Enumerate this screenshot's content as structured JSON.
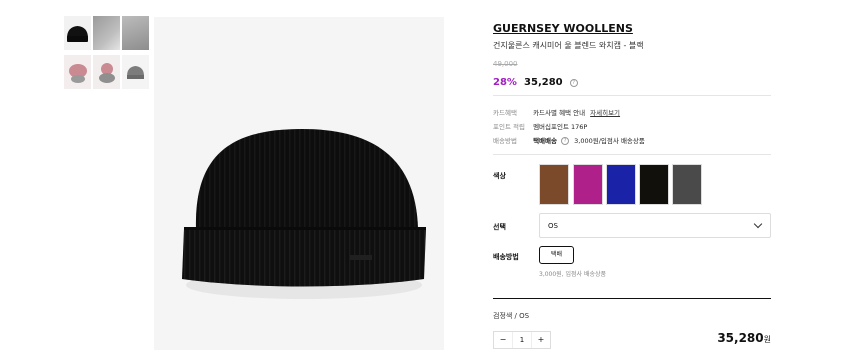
{
  "thumbnails": [
    {
      "label": "black beanie front"
    },
    {
      "label": "model side view"
    },
    {
      "label": "knit close-up"
    },
    {
      "label": "model wearing pink"
    },
    {
      "label": "model wearing pink side"
    },
    {
      "label": "grey beanie"
    }
  ],
  "product": {
    "brand": "GUERNSEY WOOLLENS",
    "name": "건지울른스 캐시미어 울 블렌드 와치캡 - 블랙",
    "original_price": "49,000",
    "discount": "28%",
    "sale_price": "35,280",
    "info_icon": "?"
  },
  "meta": {
    "card_label": "카드혜택",
    "card_value": "카드사별 혜택 안내",
    "card_link": "자세히보기",
    "point_label": "포인트 적립",
    "point_value": "멤버십포인트 176P",
    "delivery_label": "배송방법",
    "delivery_type": "택배배송",
    "delivery_value": "3,000원/입점사 배송상품"
  },
  "colors": {
    "label": "색상",
    "swatches": [
      "#7a4a2a",
      "#b0208a",
      "#1a22a8",
      "#12100a",
      "#4a4a4a"
    ]
  },
  "select": {
    "label": "선택",
    "value": "OS"
  },
  "shipping": {
    "label": "배송방법",
    "button": "택배",
    "note": "3,000원, 입점사 배송상품"
  },
  "order": {
    "option": "검정색 / OS",
    "minus": "−",
    "qty": "1",
    "plus": "+",
    "total": "35,280",
    "unit": "원"
  }
}
